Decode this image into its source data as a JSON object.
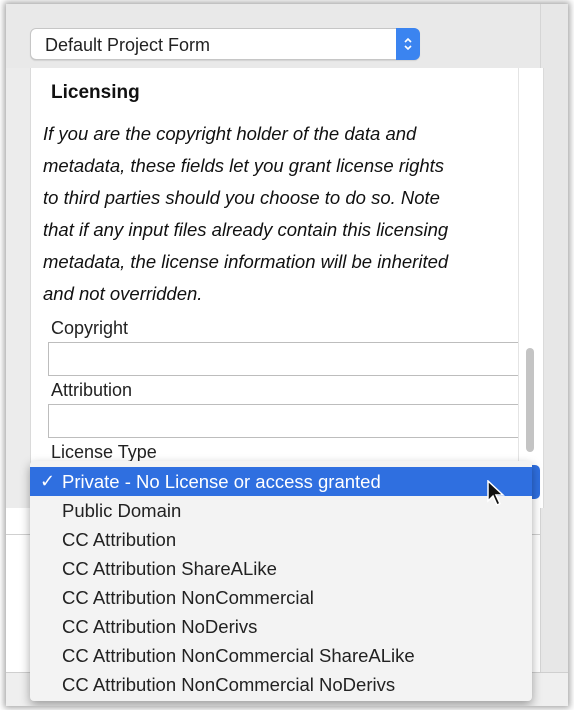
{
  "form_select": {
    "value": "Default Project Form"
  },
  "licensing": {
    "heading": "Licensing",
    "description_lines": [
      "If you are the copyright holder of the data and",
      "metadata, these fields let you grant license rights",
      "to third parties should you choose to do so.  Note",
      "that if any input files already contain this licensing",
      "metadata, the license information will be inherited",
      "and not overridden."
    ],
    "copyright_label": "Copyright",
    "copyright_value": "",
    "attribution_label": "Attribution",
    "attribution_value": "",
    "license_type_label": "License Type"
  },
  "license_dropdown": {
    "check_glyph": "✓",
    "options": [
      "Private - No License or access granted",
      "Public Domain",
      "CC Attribution",
      "CC Attribution ShareALike",
      "CC Attribution NonCommercial",
      "CC Attribution NoDerivs",
      "CC Attribution NonCommercial ShareALike",
      "CC Attribution NonCommercial NoDerivs"
    ],
    "selected_index": 0
  },
  "colors": {
    "accent": "#2f6fe0",
    "stepper": "#3b84f0"
  },
  "icons": {
    "stepper": "up-down-chevron-icon",
    "check": "checkmark-icon",
    "cursor": "mouse-pointer-icon"
  }
}
